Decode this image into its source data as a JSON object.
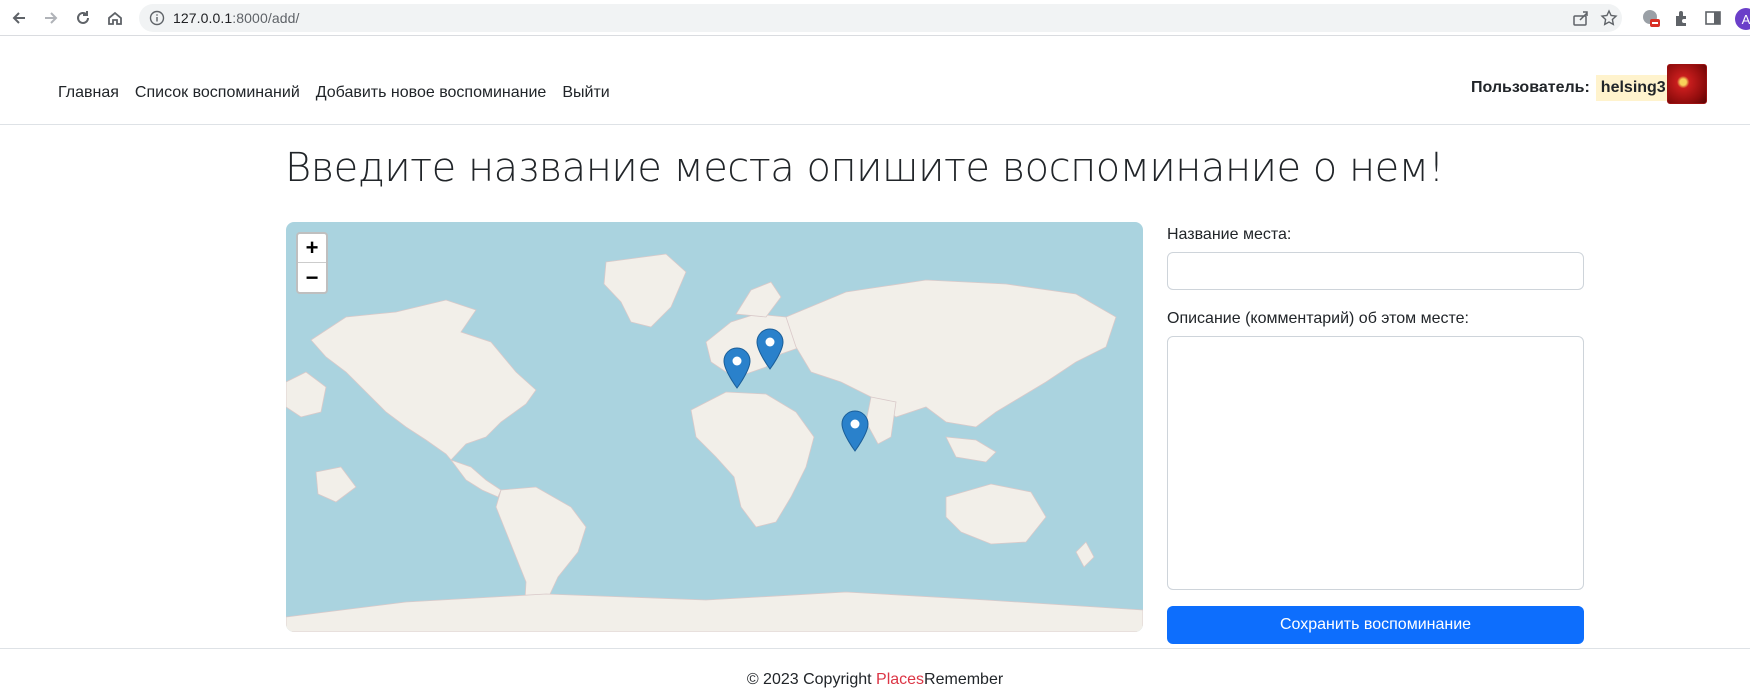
{
  "browser": {
    "url_host": "127.0.0.1",
    "url_path": ":8000/add/",
    "profile_initial": "A"
  },
  "nav": {
    "items": [
      {
        "label": "Главная"
      },
      {
        "label": "Список воспоминаний"
      },
      {
        "label": "Добавить новое воспоминание"
      },
      {
        "label": "Выйти"
      }
    ]
  },
  "user": {
    "label": "Пользователь:",
    "username": "helsing3"
  },
  "page": {
    "title": "Введите название места опишите воспоминание о нем!"
  },
  "map": {
    "zoom_in": "+",
    "zoom_out": "−",
    "markers": [
      {
        "name": "marker-europe-west"
      },
      {
        "name": "marker-europe-east"
      },
      {
        "name": "marker-southeast-asia"
      }
    ]
  },
  "form": {
    "place_label": "Название места:",
    "place_value": "",
    "description_label": "Описание (комментарий) об этом месте:",
    "description_value": "",
    "submit_label": "Сохранить воспоминание"
  },
  "footer": {
    "copyright": "© 2023 Copyright ",
    "brand_part1": "Places",
    "brand_part2": "Remember"
  },
  "colors": {
    "primary": "#0d6efd",
    "water": "#aad3df",
    "land": "#f2efe9",
    "brand_red": "#dc3545",
    "username_bg": "#fff3cd"
  }
}
